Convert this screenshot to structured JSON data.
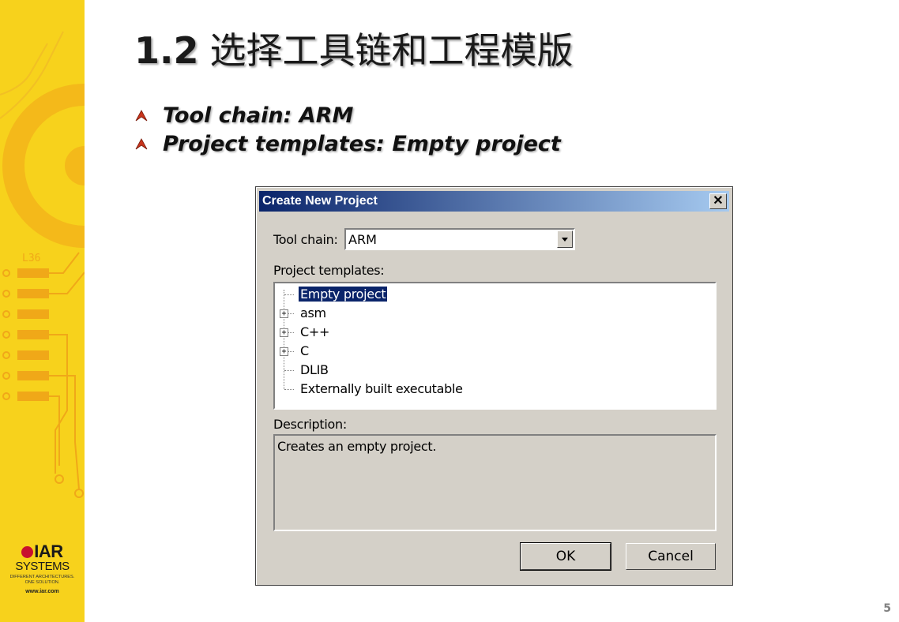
{
  "slide": {
    "title_number": "1.2",
    "title_text": "选择工具链和工程模版",
    "bullets": [
      {
        "text": "Tool chain: ARM"
      },
      {
        "text": "Project templates: Empty project"
      }
    ],
    "page_number": "5",
    "colors": {
      "band": "#f7d21c",
      "band_line": "#f0a818",
      "logo_red": "#c8102e"
    }
  },
  "logo": {
    "brand": "IAR",
    "systems": "SYSTEMS",
    "tagline_1": "DIFFERENT ARCHITECTURES.",
    "tagline_2": "ONE SOLUTION.",
    "url": "www.iar.com",
    "chip_label": "L36"
  },
  "dialog": {
    "title": "Create New Project",
    "close_label": "✕",
    "toolchain_label": "Tool chain:",
    "toolchain_value": "ARM",
    "templates_label": "Project templates:",
    "templates": [
      {
        "label": "Empty project",
        "expandable": false,
        "selected": true
      },
      {
        "label": "asm",
        "expandable": true,
        "selected": false
      },
      {
        "label": "C++",
        "expandable": true,
        "selected": false
      },
      {
        "label": "C",
        "expandable": true,
        "selected": false
      },
      {
        "label": "DLIB",
        "expandable": false,
        "selected": false
      },
      {
        "label": "Externally built executable",
        "expandable": false,
        "selected": false
      }
    ],
    "description_label": "Description:",
    "description_text": "Creates an empty project.",
    "ok_label": "OK",
    "cancel_label": "Cancel",
    "colors": {
      "face": "#d4d0c8",
      "title_start": "#0a246a",
      "title_end": "#a6caf0",
      "selection": "#0a246a"
    }
  }
}
